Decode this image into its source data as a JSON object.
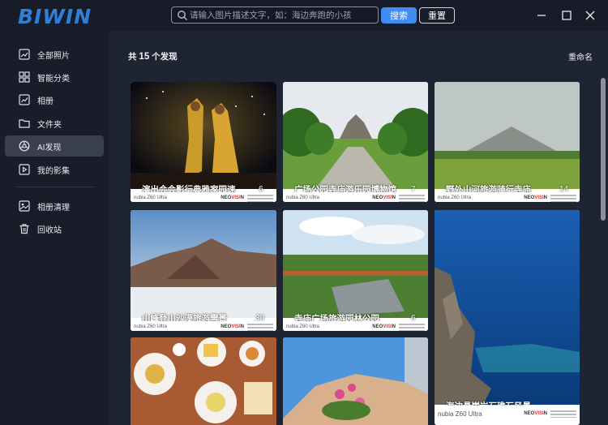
{
  "app": {
    "logo_text": "BIWIN",
    "brand_color": "#2f7fd8",
    "accent_color": "#3f8cf2"
  },
  "search": {
    "placeholder": "请输入图片描述文字，如：海边奔跑的小孩",
    "value": "",
    "search_label": "搜索",
    "reset_label": "重置"
  },
  "window_controls": [
    "minimize-icon",
    "maximize-icon",
    "close-icon"
  ],
  "sidebar": {
    "items": [
      {
        "label": "全部照片",
        "icon": "photo-icon",
        "active": false
      },
      {
        "label": "智能分类",
        "icon": "grid-icon",
        "active": false
      },
      {
        "label": "相册",
        "icon": "chart-icon",
        "active": false
      },
      {
        "label": "文件夹",
        "icon": "folder-icon",
        "active": false
      },
      {
        "label": "AI发现",
        "icon": "ai-discover-icon",
        "active": true
      },
      {
        "label": "我的影集",
        "icon": "play-icon",
        "active": false
      },
      {
        "label": "相册清理",
        "icon": "image-clean-icon",
        "active": false
      },
      {
        "label": "回收站",
        "icon": "trash-icon",
        "active": false
      }
    ]
  },
  "main": {
    "count_prefix": "共",
    "count_value": "15",
    "count_suffix": "个发现",
    "rename_label": "重命名",
    "cards": [
      {
        "name": "演出会会影行典雅家园速",
        "count": "6",
        "model": "nubia Z60 Ultra",
        "brand_prefix": "NEO",
        "brand_mid": "VISI",
        "brand_suffix": "N"
      },
      {
        "name": "广场公园寺庙游乐园博物馆",
        "count": "7",
        "model": "nubia Z60 Ultra",
        "brand_prefix": "NEO",
        "brand_mid": "VISI",
        "brand_suffix": "N"
      },
      {
        "name": "野外山河旅游骑行寺庙",
        "count": "14",
        "model": "nubia Z60 Ultra",
        "brand_prefix": "NEO",
        "brand_mid": "VISI",
        "brand_suffix": "N"
      },
      {
        "name": "山峰登山沙漠旅游雪景",
        "count": "30",
        "model": "nubia Z60 Ultra",
        "brand_prefix": "NEO",
        "brand_mid": "VISI",
        "brand_suffix": "N"
      },
      {
        "name": "寺庙广场旅游园林公园",
        "count": "6",
        "model": "nubia Z60 Ultra",
        "brand_prefix": "NEO",
        "brand_mid": "VISI",
        "brand_suffix": "N"
      },
      {
        "name": "海边悬崖岩石礁石风景",
        "count": "",
        "model": "nubia Z60 Ultra",
        "brand_prefix": "NEO",
        "brand_mid": "VISI",
        "brand_suffix": "N"
      },
      {
        "name": "",
        "count": "",
        "model": "",
        "brand_prefix": "",
        "brand_mid": "",
        "brand_suffix": ""
      },
      {
        "name": "",
        "count": "",
        "model": "",
        "brand_prefix": "",
        "brand_mid": "",
        "brand_suffix": ""
      }
    ]
  }
}
